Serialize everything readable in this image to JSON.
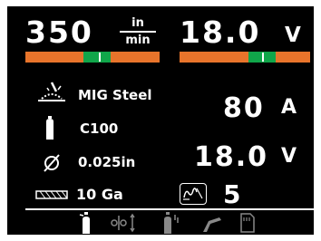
{
  "top": {
    "wire_speed": {
      "value": "350",
      "unit_top": "in",
      "unit_bottom": "min",
      "level": 0.45
    },
    "voltage": {
      "value": "18.0",
      "unit": "V",
      "level": 0.53
    }
  },
  "settings": {
    "process": "MIG Steel",
    "gas": "C100",
    "wire_diameter": "0.025in",
    "material_thickness": "10 Ga"
  },
  "readouts": {
    "current": {
      "value": "80",
      "unit": "A"
    },
    "voltage": {
      "value": "18.0",
      "unit": "V"
    },
    "inductance": {
      "value": "5"
    }
  },
  "tabs": [
    {
      "icon": "gas-bottle-icon",
      "active": true
    },
    {
      "icon": "settings-adjust-icon",
      "active": false
    },
    {
      "icon": "gas-purge-icon",
      "active": false
    },
    {
      "icon": "torch-icon",
      "active": false
    },
    {
      "icon": "memory-card-icon",
      "active": false
    }
  ],
  "colors": {
    "bar_orange": "#e8742b",
    "bar_green": "#10a64a",
    "background": "#000000",
    "text": "#ffffff"
  }
}
